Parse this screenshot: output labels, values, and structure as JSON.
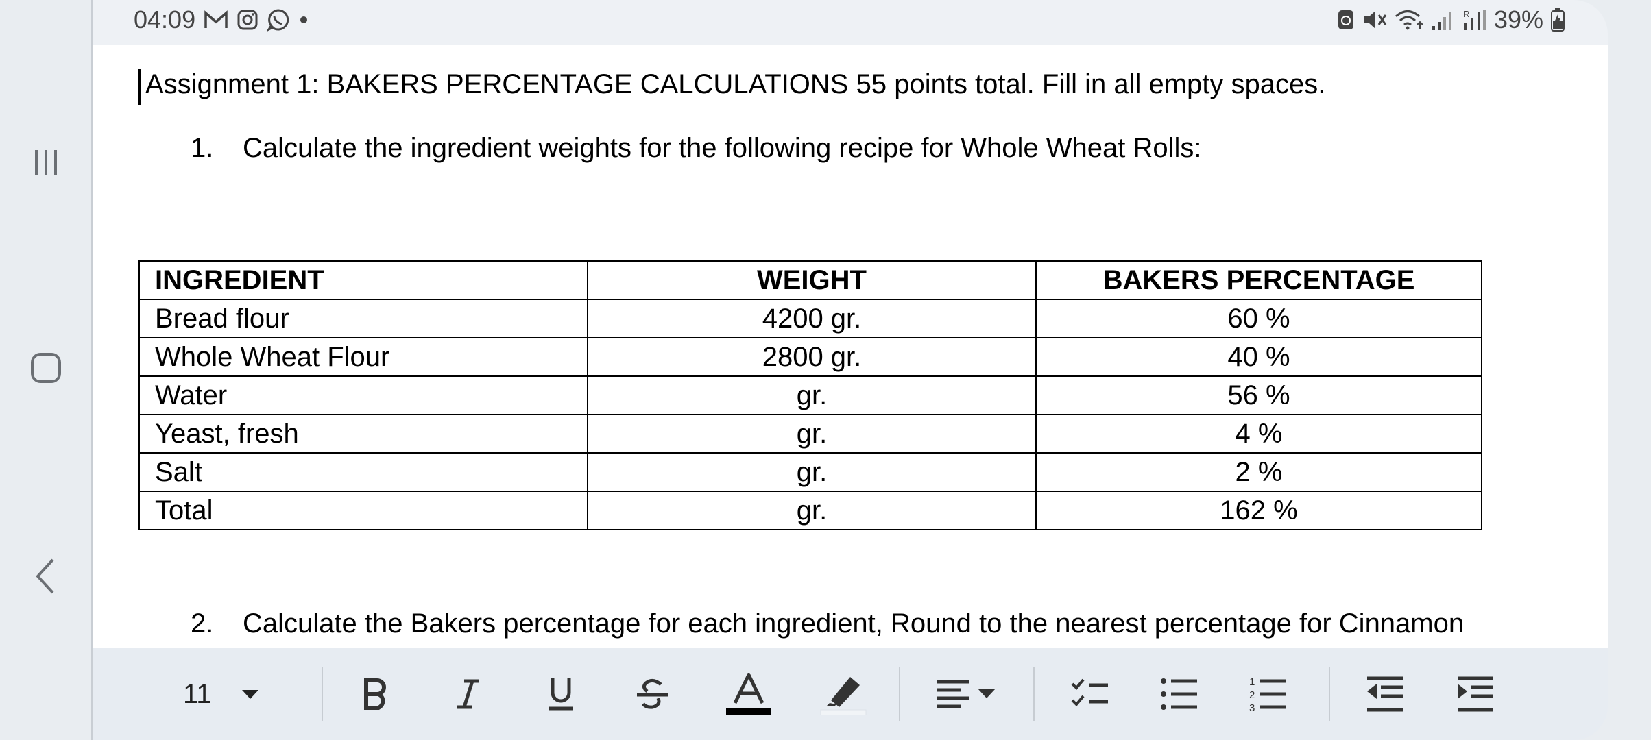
{
  "status_bar": {
    "time": "04:09",
    "battery": "39%",
    "left_icons": [
      "gmail-icon",
      "instagram-icon",
      "whatsapp-icon",
      "dot-icon"
    ],
    "right_icons": [
      "battery-saver-icon",
      "mute-icon",
      "wifi-icon",
      "signal-icon",
      "signal-roaming-icon",
      "battery-icon"
    ]
  },
  "document": {
    "title_line": "Assignment 1: BAKERS PERCENTAGE CALCULATIONS 55 points total. Fill in all empty spaces.",
    "questions": [
      {
        "number": "1.",
        "text": "Calculate the ingredient weights for the following recipe for Whole Wheat Rolls:"
      },
      {
        "number": "2.",
        "text": "Calculate the Bakers percentage for each ingredient, Round to the nearest percentage for Cinnamon"
      }
    ],
    "table": {
      "headers": [
        "INGREDIENT",
        "WEIGHT",
        "BAKERS PERCENTAGE"
      ],
      "rows": [
        [
          "Bread flour",
          "4200 gr.",
          "60 %"
        ],
        [
          "Whole Wheat Flour",
          "2800 gr.",
          "40 %"
        ],
        [
          "Water",
          "    gr.",
          "56 %"
        ],
        [
          "Yeast, fresh",
          "    gr.",
          "  4 %"
        ],
        [
          "Salt",
          "   gr.",
          "  2 %"
        ],
        [
          "Total",
          "   gr.",
          "162 %"
        ]
      ]
    }
  },
  "toolbar": {
    "font_size": "11",
    "buttons": [
      "font-size-dropdown",
      "bold",
      "italic",
      "underline",
      "strikethrough",
      "text-color",
      "highlight",
      "align",
      "checklist",
      "bulleted-list",
      "numbered-list",
      "decrease-indent",
      "increase-indent"
    ],
    "text_color": "#000000"
  },
  "colors": {
    "background": "#e9edf1",
    "document": "#ffffff",
    "toolbar": "#e7ecf2"
  }
}
